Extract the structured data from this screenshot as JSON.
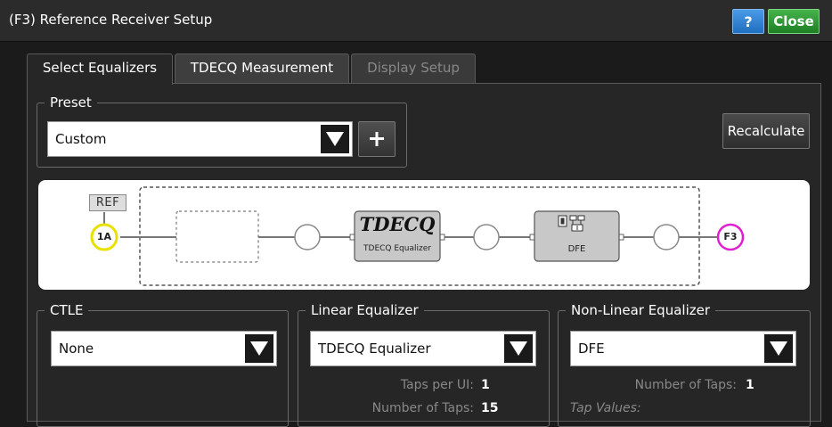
{
  "window": {
    "title": "(F3) Reference Receiver Setup",
    "help_label": "?",
    "close_label": "Close"
  },
  "tabs": [
    {
      "label": "Select Equalizers",
      "state": "active"
    },
    {
      "label": "TDECQ Measurement",
      "state": "normal"
    },
    {
      "label": "Display Setup",
      "state": "disabled"
    }
  ],
  "preset": {
    "legend": "Preset",
    "value": "Custom",
    "add_icon": "plus-icon"
  },
  "recalculate_label": "Recalculate",
  "diagram": {
    "ref_label": "REF",
    "source_label": "1A",
    "source_color": "#e8e000",
    "output_label": "F3",
    "output_color": "#e020d0",
    "tdecq_title": "TDECQ",
    "tdecq_caption": "TDECQ Equalizer",
    "dfe_caption": "DFE"
  },
  "ctle": {
    "legend": "CTLE",
    "value": "None"
  },
  "linear_equalizer": {
    "legend": "Linear Equalizer",
    "value": "TDECQ Equalizer",
    "taps_per_ui_label": "Taps per UI:",
    "taps_per_ui_value": "1",
    "num_taps_label": "Number of Taps:",
    "num_taps_value": "15"
  },
  "nonlinear_equalizer": {
    "legend": "Non-Linear Equalizer",
    "value": "DFE",
    "num_taps_label": "Number of Taps:",
    "num_taps_value": "1",
    "tap_values_label": "Tap Values:"
  }
}
